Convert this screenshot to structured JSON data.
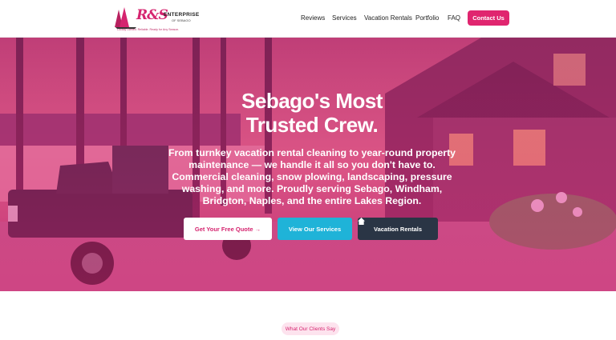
{
  "brand": {
    "mark": "R&S",
    "name": "ENTERPRISE",
    "subname": "OF SEBAGO",
    "tagline": "Locally Owned. Reliable. Ready for Any Season."
  },
  "nav": {
    "items": [
      "Reviews",
      "Services",
      "Vacation Rentals",
      "Portfolio",
      "FAQ"
    ],
    "cta": "Contact Us"
  },
  "hero": {
    "title_line1": "Sebago's Most",
    "title_line2": "Trusted Crew.",
    "subtitle": "From turnkey vacation rental cleaning to year-round property maintenance — we handle it all so you don't have to. Commercial cleaning, snow plowing, landscaping, pressure washing, and more. Proudly serving Sebago, Windham, Bridgton, Naples, and the entire Lakes Region.",
    "btn_quote": "Get Your Free Quote →",
    "btn_services": "View Our Services",
    "btn_rentals": "Vacation Rentals"
  },
  "testimonials": {
    "pill": "What Our Clients Say"
  },
  "icons": {
    "rentals": "home-icon",
    "logo": "pine-trees-icon"
  },
  "colors": {
    "accent": "#e0256f",
    "teal": "#1fb3d8",
    "dark": "#2a3545"
  }
}
